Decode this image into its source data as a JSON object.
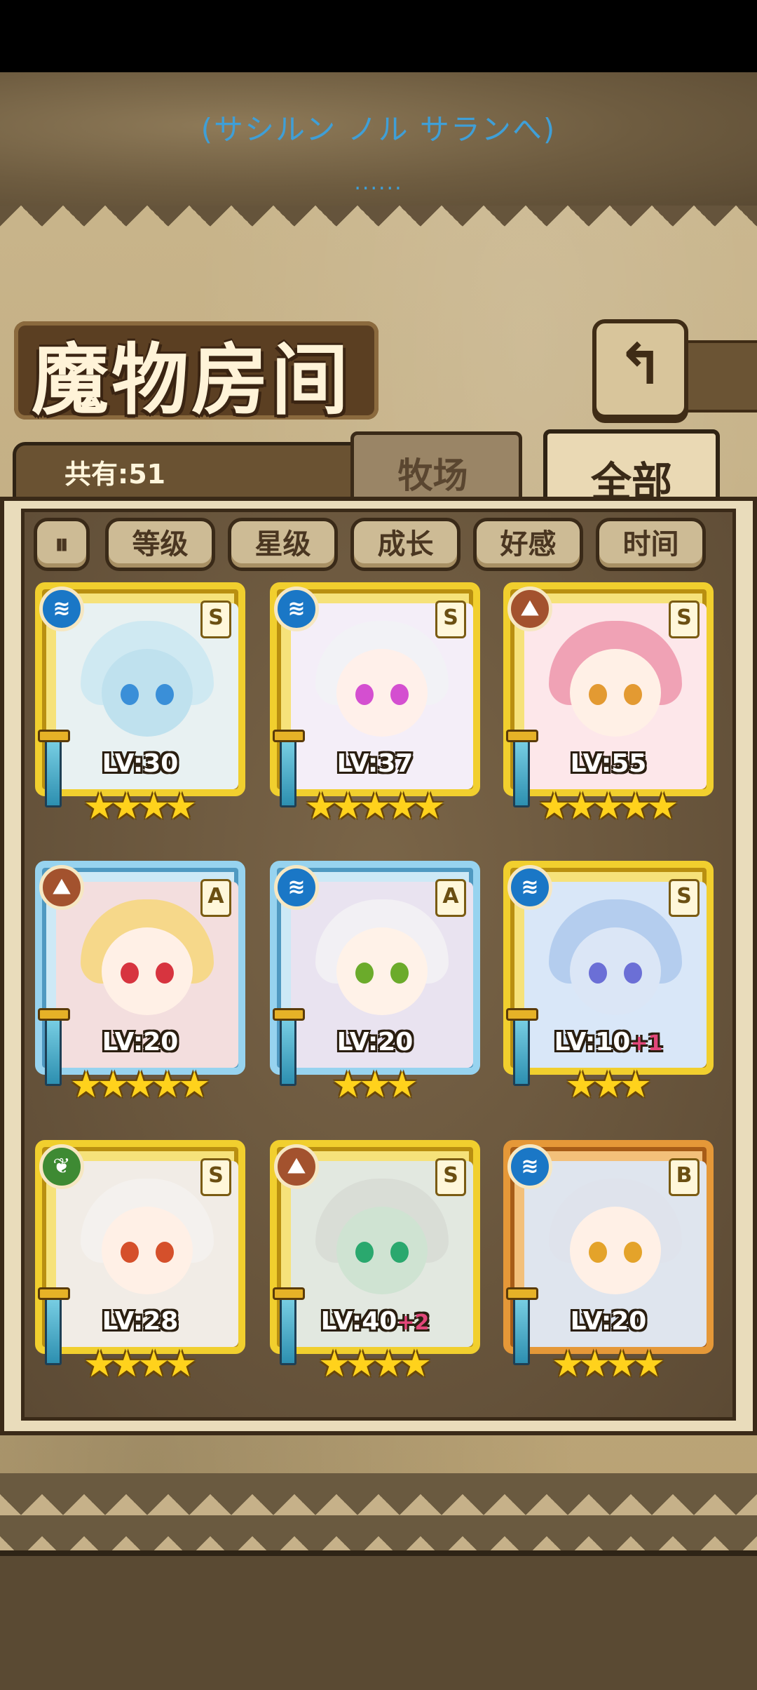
{
  "dialog": {
    "line": "(サシルン ノル サランへ)",
    "dots": "......"
  },
  "header": {
    "title": "魔物房间",
    "back_glyph": "↰"
  },
  "tabs": {
    "total_label": "共有:51",
    "ranch": "牧场",
    "all": "全部"
  },
  "sort": {
    "toggle_glyph": "⏸",
    "buttons": [
      "等级",
      "星级",
      "成长",
      "好感",
      "时间"
    ]
  },
  "monsters": [
    {
      "element": "water",
      "element_glyph": "≋",
      "rank": "S",
      "level": "LV:30",
      "bonus": "",
      "stars": 4,
      "frame": "gold",
      "hair": "#cfe9f2",
      "skin": "#bfe1ee",
      "eye": "#3a8fd8",
      "bg": "#e8f1f2"
    },
    {
      "element": "water",
      "element_glyph": "≋",
      "rank": "S",
      "level": "LV:37",
      "bonus": "",
      "stars": 5,
      "frame": "gold",
      "hair": "#f2f2f6",
      "skin": "#fff0ea",
      "eye": "#d44fd0",
      "bg": "#f4eef8"
    },
    {
      "element": "earth",
      "element_glyph": "⛰",
      "rank": "S",
      "level": "LV:55",
      "bonus": "",
      "stars": 5,
      "frame": "gold",
      "hair": "#f0a2b5",
      "skin": "#fff0e6",
      "eye": "#e39a32",
      "bg": "#fde7ea"
    },
    {
      "element": "earth",
      "element_glyph": "⛰",
      "rank": "A",
      "level": "LV:20",
      "bonus": "",
      "stars": 5,
      "frame": "blue",
      "hair": "#f6d88a",
      "skin": "#fff0e6",
      "eye": "#d7343f",
      "bg": "#f3dede"
    },
    {
      "element": "water",
      "element_glyph": "≋",
      "rank": "A",
      "level": "LV:20",
      "bonus": "",
      "stars": 3,
      "frame": "blue",
      "hair": "#f2f0f4",
      "skin": "#fff2e8",
      "eye": "#6bab2b",
      "bg": "#e9e3f0"
    },
    {
      "element": "water",
      "element_glyph": "≋",
      "rank": "S",
      "level": "LV:10",
      "bonus": "+1",
      "stars": 3,
      "frame": "gold",
      "hair": "#b4cdee",
      "skin": "#dbe6f6",
      "eye": "#6b6fd6",
      "bg": "#d9e7f8"
    },
    {
      "element": "wood",
      "element_glyph": "❦",
      "rank": "S",
      "level": "LV:28",
      "bonus": "",
      "stars": 4,
      "frame": "gold",
      "hair": "#f4f1ee",
      "skin": "#fff0e6",
      "eye": "#d5502b",
      "bg": "#f1ece6"
    },
    {
      "element": "earth",
      "element_glyph": "⛰",
      "rank": "S",
      "level": "LV:40",
      "bonus": "+2",
      "stars": 4,
      "frame": "gold",
      "hair": "#d9ddd6",
      "skin": "#cfe3d2",
      "eye": "#2aa86e",
      "bg": "#e2e8e0"
    },
    {
      "element": "water",
      "element_glyph": "≋",
      "rank": "B",
      "level": "LV:20",
      "bonus": "",
      "stars": 4,
      "frame": "bronze",
      "hair": "#dfe3ec",
      "skin": "#fff0e6",
      "eye": "#e4a32a",
      "bg": "#dfe5ee"
    }
  ]
}
